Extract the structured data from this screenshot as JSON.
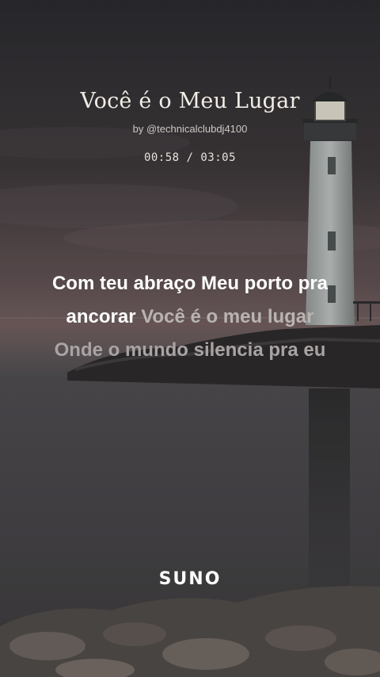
{
  "song": {
    "title": "Você é o Meu Lugar",
    "byline": "by @technicalclubdj4100",
    "time": "00:58 / 03:05"
  },
  "lyrics": {
    "line1": "Com teu abraço Meu porto pra",
    "line2_sung": "ancorar",
    "line2_unsung": "Você é o meu lugar",
    "line3": "Onde o mundo silencia pra eu"
  },
  "brand": {
    "logo_text": "SUNO"
  },
  "colors": {
    "sky_top": "#2d2d31",
    "sky_dusk": "#6e5a5c",
    "water": "#4a4a4e",
    "lyric_active": "#ffffff",
    "lyric_inactive": "#b9b4b2"
  }
}
